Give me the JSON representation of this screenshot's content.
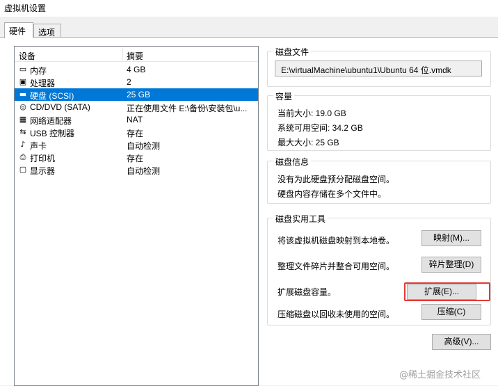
{
  "window": {
    "title": "虚拟机设置"
  },
  "tabs": [
    {
      "label": "硬件"
    },
    {
      "label": "选项"
    }
  ],
  "device_list": {
    "columns": {
      "device": "设备",
      "summary": "摘要"
    },
    "rows": [
      {
        "icon": "memory-icon",
        "glyph": "▭",
        "name": "内存",
        "summary": "4 GB"
      },
      {
        "icon": "processor-icon",
        "glyph": "▣",
        "name": "处理器",
        "summary": "2"
      },
      {
        "icon": "hard-disk-icon",
        "glyph": "▬",
        "name": "硬盘 (SCSI)",
        "summary": "25 GB",
        "selected": true
      },
      {
        "icon": "cd-dvd-icon",
        "glyph": "◎",
        "name": "CD/DVD (SATA)",
        "summary": "正在使用文件 E:\\备份\\安装包\\u..."
      },
      {
        "icon": "network-adapter-icon",
        "glyph": "▦",
        "name": "网络适配器",
        "summary": "NAT"
      },
      {
        "icon": "usb-icon",
        "glyph": "⇆",
        "name": "USB 控制器",
        "summary": "存在"
      },
      {
        "icon": "sound-card-icon",
        "glyph": "♪",
        "name": "声卡",
        "summary": "自动检测"
      },
      {
        "icon": "printer-icon",
        "glyph": "⎙",
        "name": "打印机",
        "summary": "存在"
      },
      {
        "icon": "display-icon",
        "glyph": "▢",
        "name": "显示器",
        "summary": "自动检测"
      }
    ]
  },
  "disk_file": {
    "legend": "磁盘文件",
    "path": "E:\\virtualMachine\\ubuntu1\\Ubuntu 64 位.vmdk"
  },
  "capacity": {
    "legend": "容量",
    "current_size": "当前大小: 19.0 GB",
    "system_free": "系统可用空间: 34.2 GB",
    "max_size": "最大大小: 25 GB"
  },
  "disk_info": {
    "legend": "磁盘信息",
    "line1": "没有为此硬盘预分配磁盘空间。",
    "line2": "硬盘内容存储在多个文件中。"
  },
  "disk_utilities": {
    "legend": "磁盘实用工具",
    "map_desc": "将该虚拟机磁盘映射到本地卷。",
    "map_button": "映射(M)...",
    "defrag_desc": "整理文件碎片并整合可用空间。",
    "defrag_button": "碎片整理(D)",
    "expand_desc": "扩展磁盘容量。",
    "expand_button": "扩展(E)...",
    "compact_desc": "压缩磁盘以回收未使用的空间。",
    "compact_button": "压缩(C)"
  },
  "advanced_button": "高级(V)...",
  "watermark": "@稀土掘金技术社区",
  "colors": {
    "selection": "#0078d7",
    "highlight": "#e53935"
  }
}
